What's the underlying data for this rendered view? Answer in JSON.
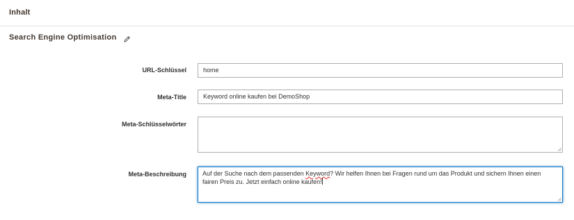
{
  "section": {
    "title": "Inhalt"
  },
  "seo": {
    "title": "Search Engine Optimisation"
  },
  "fields": {
    "url_key": {
      "label": "URL-Schlüssel",
      "value": "home"
    },
    "meta_title": {
      "label": "Meta-Title",
      "value": "Keyword online kaufen bei DemoShop"
    },
    "meta_keywords": {
      "label": "Meta-Schlüsselwörter",
      "value": ""
    },
    "meta_description": {
      "label": "Meta-Beschreibung",
      "text_before": "Auf der Suche nach dem passenden ",
      "keyword": "Keyword",
      "text_after": "? Wir helfen Ihnen bei Fragen rund um das Produkt und sichern Ihnen einen fairen Preis zu. Jetzt einfach online kaufen!"
    }
  },
  "icons": {
    "edit": "pencil-icon",
    "resize": "resize-grip-icon"
  },
  "colors": {
    "heading": "#41362f",
    "border": "#adadad",
    "focus": "#1979c3",
    "spellcheck": "#e02b27"
  }
}
